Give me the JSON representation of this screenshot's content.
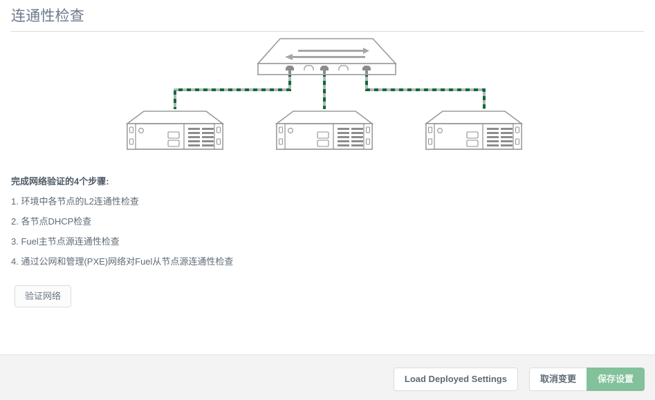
{
  "header": {
    "title": "连通性检查"
  },
  "diagram": {
    "name": "network-connectivity-diagram",
    "switch": {
      "label": "switch",
      "ports_total": 5,
      "ports_connected": 3,
      "connected_port_indexes": [
        0,
        2,
        4
      ]
    },
    "nodes": [
      {
        "label": "server-node-1"
      },
      {
        "label": "server-node-2"
      },
      {
        "label": "server-node-3"
      }
    ],
    "link_style": "dashed",
    "colors": {
      "link": "#0b6b3a",
      "link_shadow": "#b3b3b3",
      "device_outline": "#9a9a9a",
      "device_fill": "#ffffff",
      "device_detail": "#8c8c8c"
    }
  },
  "steps": {
    "heading": "完成网络验证的4个步骤:",
    "items": [
      "1. 环境中各节点的L2连通性检查",
      "2. 各节点DHCP检查",
      "3. Fuel主节点源连通性检查",
      "4. 通过公网和管理(PXE)网络对Fuel从节点源连通性检查"
    ]
  },
  "actions": {
    "verify_network_label": "验证网络"
  },
  "footer": {
    "load_deployed_settings_label": "Load Deployed Settings",
    "cancel_changes_label": "取消变更",
    "save_settings_label": "保存设置",
    "save_color": "#82c19a"
  }
}
